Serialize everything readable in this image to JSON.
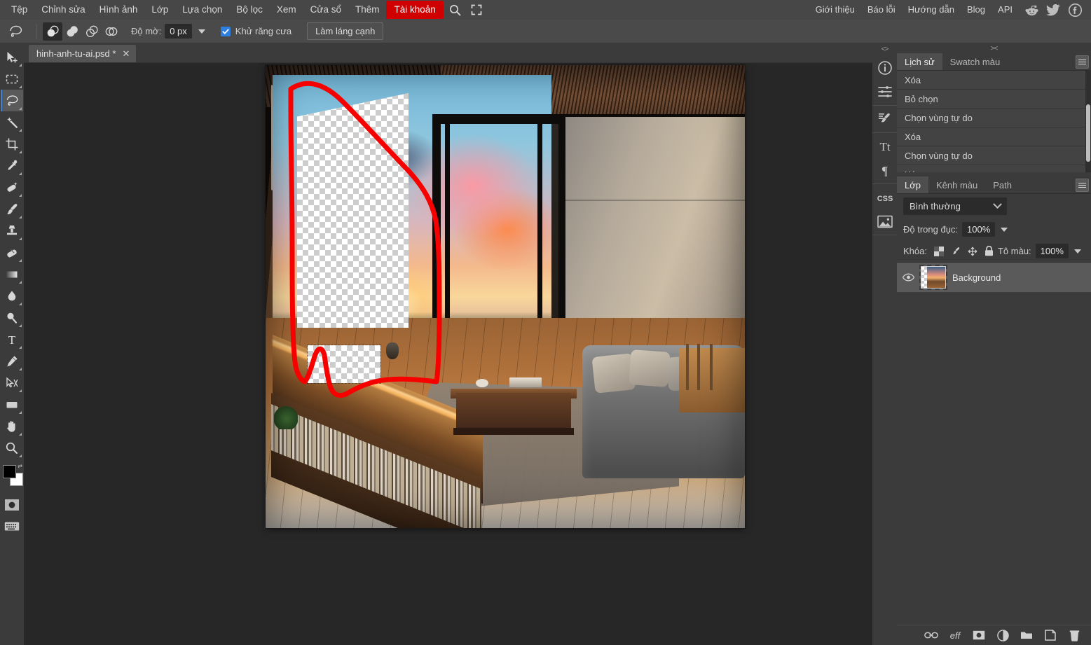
{
  "menubar": {
    "left_items": [
      {
        "label": "Tệp",
        "name": "menu-file"
      },
      {
        "label": "Chỉnh sửa",
        "name": "menu-edit"
      },
      {
        "label": "Hình ảnh",
        "name": "menu-image"
      },
      {
        "label": "Lớp",
        "name": "menu-layer"
      },
      {
        "label": "Lựa chọn",
        "name": "menu-select"
      },
      {
        "label": "Bộ lọc",
        "name": "menu-filter"
      },
      {
        "label": "Xem",
        "name": "menu-view"
      },
      {
        "label": "Cửa sổ",
        "name": "menu-window"
      },
      {
        "label": "Thêm",
        "name": "menu-more"
      }
    ],
    "account_label": "Tài khoản",
    "account_color": "#d00000",
    "icons": [
      "search-icon",
      "fullscreen-icon"
    ],
    "right_items": [
      {
        "label": "Giới thiệu",
        "name": "menu-about"
      },
      {
        "label": "Báo lỗi",
        "name": "menu-report-bug"
      },
      {
        "label": "Hướng dẫn",
        "name": "menu-tutorial"
      },
      {
        "label": "Blog",
        "name": "menu-blog"
      },
      {
        "label": "API",
        "name": "menu-api"
      }
    ],
    "social": [
      "reddit-icon",
      "twitter-icon",
      "facebook-icon"
    ]
  },
  "optionsbar": {
    "tool_preview": "lasso-tool-icon",
    "boolean_modes": [
      "new-selection",
      "add-to-selection",
      "subtract-from-selection",
      "intersect-selection"
    ],
    "active_boolean_index": 0,
    "feather_label": "Độ mờ:",
    "feather_value": "0 px",
    "antialias_label": "Khử răng cưa",
    "antialias_checked": true,
    "refine_label": "Làm láng cạnh"
  },
  "toolbar": {
    "tools": [
      {
        "name": "move-tool",
        "icon": "move-icon"
      },
      {
        "name": "marquee-tool",
        "icon": "rectangular-marquee-icon"
      },
      {
        "name": "lasso-tool",
        "icon": "lasso-icon",
        "selected": true
      },
      {
        "name": "magic-wand-tool",
        "icon": "magic-wand-icon"
      },
      {
        "name": "crop-tool",
        "icon": "crop-icon"
      },
      {
        "name": "eyedropper-tool",
        "icon": "eyedropper-icon"
      },
      {
        "name": "healing-brush-tool",
        "icon": "healing-brush-icon"
      },
      {
        "name": "brush-tool",
        "icon": "paintbrush-icon"
      },
      {
        "name": "clone-stamp-tool",
        "icon": "clone-stamp-icon"
      },
      {
        "name": "eraser-tool",
        "icon": "eraser-icon"
      },
      {
        "name": "gradient-tool",
        "icon": "gradient-icon"
      },
      {
        "name": "blur-tool",
        "icon": "water-drop-icon"
      },
      {
        "name": "dodge-tool",
        "icon": "dodge-icon"
      },
      {
        "name": "type-tool",
        "icon": "text-t-icon"
      },
      {
        "name": "pen-tool",
        "icon": "pen-icon"
      },
      {
        "name": "path-select-tool",
        "icon": "path-selection-icon"
      },
      {
        "name": "shape-tool",
        "icon": "rectangle-shape-icon"
      },
      {
        "name": "hand-tool",
        "icon": "hand-icon"
      },
      {
        "name": "zoom-tool",
        "icon": "magnifier-icon"
      }
    ],
    "foreground_color": "#000000",
    "background_color": "#ffffff",
    "quick_mask": "quick-mask-icon",
    "keyboard": "keyboard-icon"
  },
  "document": {
    "tab_title": "hinh-anh-tu-ai.psd *",
    "close_label": "✕",
    "canvas_description": "Ảnh nội thất phòng khách với cửa sổ nhìn ra hoàng hôn, có vùng đã xóa trong suốt và nét vẽ đỏ đánh dấu"
  },
  "rail": {
    "collapse_left": "<>",
    "buttons": [
      {
        "name": "info-panel-icon",
        "icon": "info-circle-icon"
      },
      {
        "name": "adjustments-panel-icon",
        "icon": "sliders-icon"
      },
      {
        "name": "brushes-panel-icon",
        "icon": "brush-settings-icon"
      },
      {
        "name": "character-panel-icon",
        "icon": "character-tt-icon"
      },
      {
        "name": "paragraph-panel-icon",
        "icon": "paragraph-pilcrow-icon"
      },
      {
        "name": "css-panel-icon",
        "icon": "css-icon"
      },
      {
        "name": "image-panel-icon",
        "icon": "picture-icon"
      }
    ]
  },
  "history_panel": {
    "collapse_label": "><",
    "tabs": [
      {
        "label": "Lịch sử",
        "name": "tab-history",
        "active": true
      },
      {
        "label": "Swatch màu",
        "name": "tab-swatches",
        "active": false
      }
    ],
    "menu_icon": "hamburger-menu-icon",
    "items": [
      "Xóa",
      "Bỏ chọn",
      "Chọn vùng tự do",
      "Xóa",
      "Chọn vùng tự do",
      "Xóa"
    ]
  },
  "layers_panel": {
    "tabs": [
      {
        "label": "Lớp",
        "name": "tab-layers",
        "active": true
      },
      {
        "label": "Kênh màu",
        "name": "tab-channels",
        "active": false
      },
      {
        "label": "Path",
        "name": "tab-paths",
        "active": false
      }
    ],
    "menu_icon": "hamburger-menu-icon",
    "blend_mode": "Bình thường",
    "opacity_label": "Độ trong đục:",
    "opacity_value": "100%",
    "lock_label": "Khóa:",
    "lock_icons": [
      "transparency-lock-icon",
      "paint-lock-icon",
      "move-lock-icon",
      "all-lock-icon"
    ],
    "fill_label": "Tô màu:",
    "fill_value": "100%",
    "layers": [
      {
        "name": "Background",
        "visible": true,
        "selected": true
      }
    ],
    "footer_buttons": [
      {
        "name": "link-layers-button",
        "icon": "link-icon",
        "label": ""
      },
      {
        "name": "layer-effects-button",
        "icon": "effects-fx-icon",
        "label": "eff"
      },
      {
        "name": "add-mask-button",
        "icon": "mask-icon",
        "label": ""
      },
      {
        "name": "adjustment-layer-button",
        "icon": "half-circle-icon",
        "label": ""
      },
      {
        "name": "new-group-button",
        "icon": "folder-icon",
        "label": ""
      },
      {
        "name": "new-layer-button",
        "icon": "new-layer-icon",
        "label": ""
      },
      {
        "name": "delete-layer-button",
        "icon": "trash-icon",
        "label": ""
      }
    ]
  }
}
